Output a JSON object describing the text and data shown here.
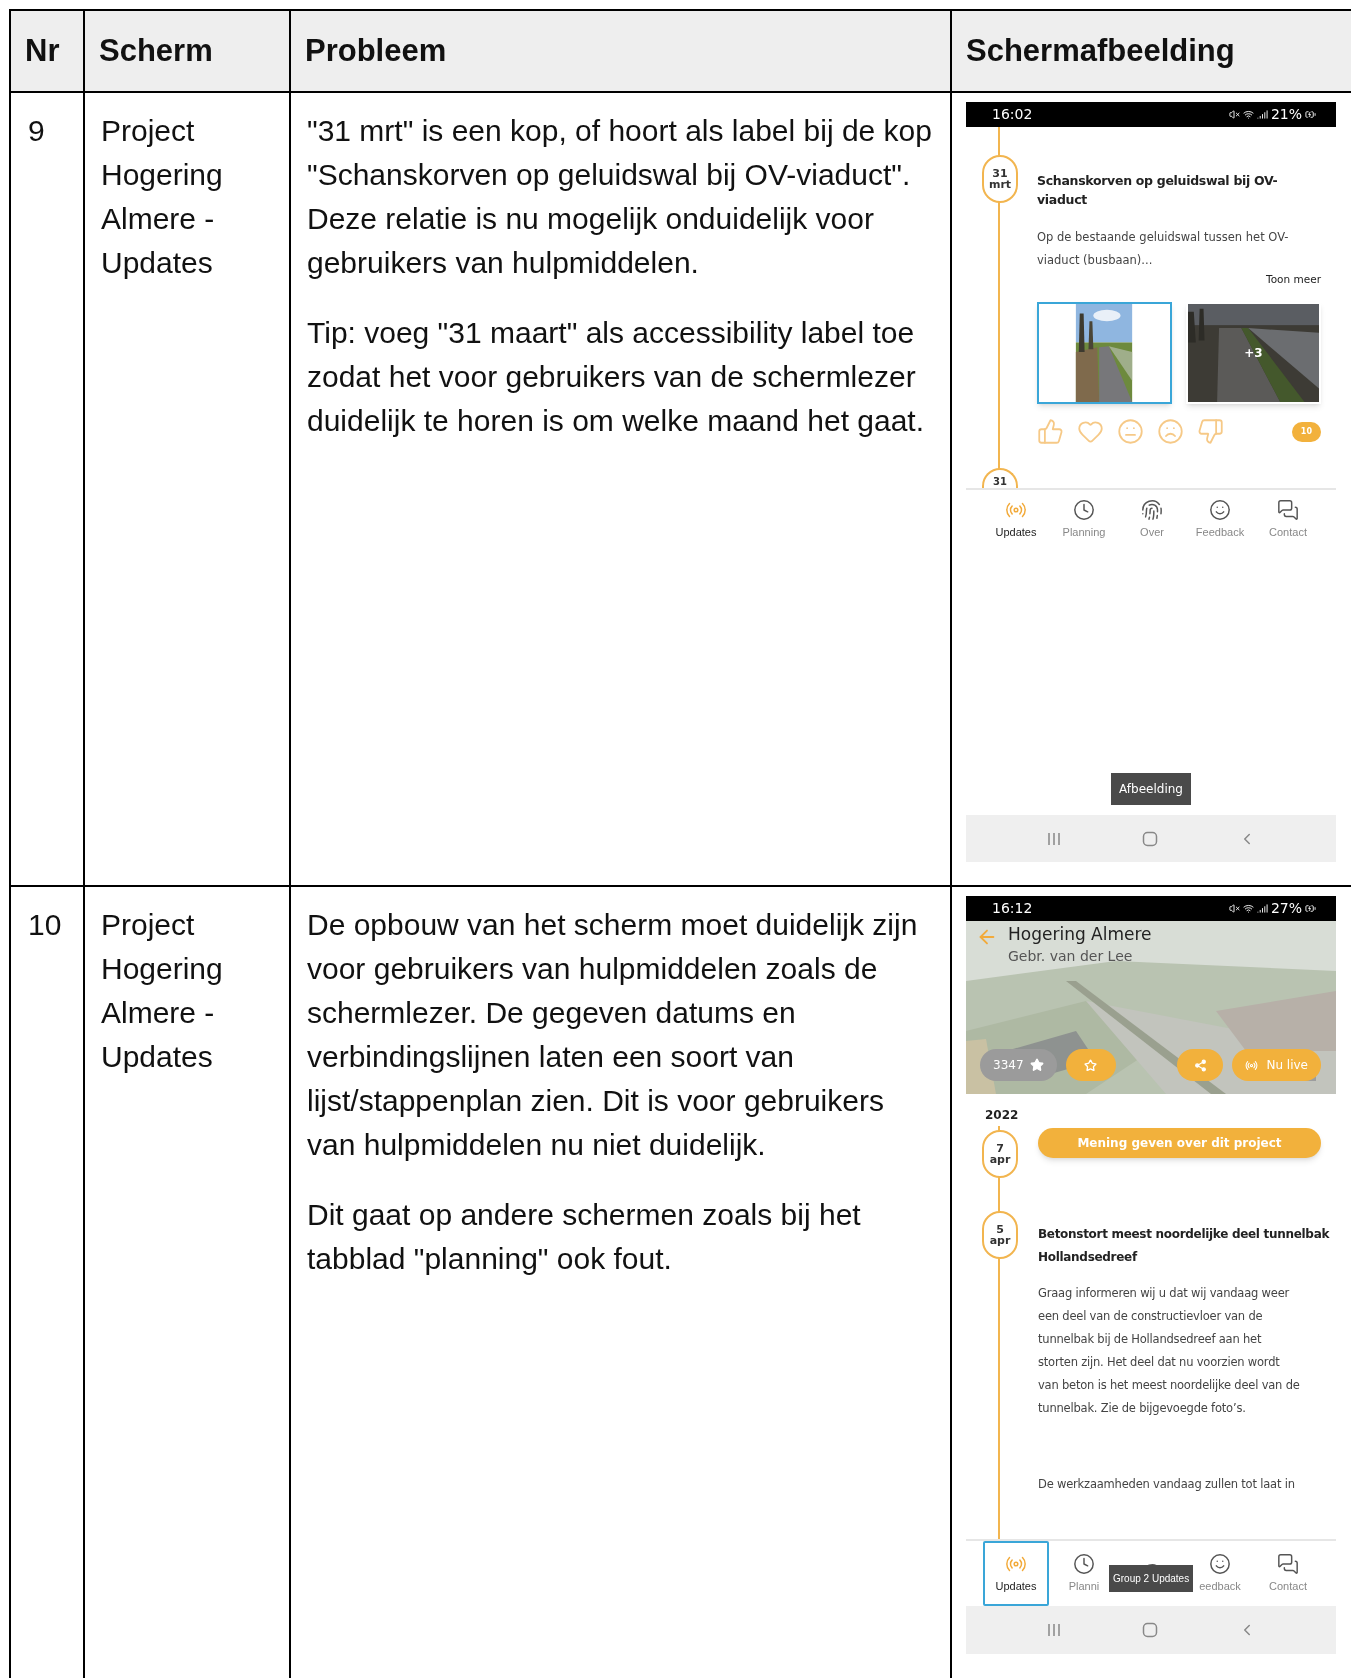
{
  "table": {
    "columns": [
      "Nr",
      "Scherm",
      "Probleem",
      "Schermafbeelding"
    ],
    "rows": [
      {
        "nr": "9",
        "screen": "Project Hogering Almere - Updates",
        "problem": [
          "\"31 mrt\" is een kop, of hoort als label bij de kop \"Schanskorven op geluidswal bij OV-viaduct\". Deze relatie is nu mogelijk onduidelijk voor gebruikers van hulpmiddelen.",
          "Tip: voeg \"31 maart\" als accessibility label toe zodat het voor gebruikers van de schermlezer duidelijk te horen is om welke maand het gaat."
        ],
        "screenshot": {
          "kind": "update_detail",
          "time": "16:02",
          "battery": "21%",
          "day": "31",
          "month": "mrt",
          "title": "Schanskorven op geluidswal bij OV-viaduct",
          "excerpt": [
            "Op de bestaande geluidswal tussen het OV-",
            "viaduct (busbaan)..."
          ],
          "more": "Toon meer",
          "images": [
            {
              "kind": "picture",
              "focused": true
            },
            {
              "kind": "picture",
              "focused": false,
              "overlay": "+3"
            }
          ],
          "reaction_count": "10",
          "next_day": "31",
          "nav": [
            {
              "label": "Updates",
              "selected": true,
              "focused": false
            },
            {
              "label": "Planning",
              "selected": false,
              "focused": false
            },
            {
              "label": "Over",
              "selected": false,
              "focused": false
            },
            {
              "label": "Feedback",
              "selected": false,
              "focused": false
            },
            {
              "label": "Contact",
              "selected": false,
              "focused": false
            }
          ],
          "tooltip": "Afbeelding"
        }
      },
      {
        "nr": "10",
        "screen": "Project Hogering Almere - Updates",
        "problem": [
          "De opbouw van het scherm moet duidelijk zijn voor gebruikers van hulpmiddelen zoals de schermlezer. De gegeven datums en verbindingslijnen laten een soort van lijst/stappenplan zien. Dit is voor gebruikers van hulpmiddelen nu niet duidelijk.",
          "Dit gaat op andere schermen zoals bij het tabblad \"planning\" ook fout."
        ],
        "screenshot": {
          "kind": "project_timeline",
          "time": "16:12",
          "battery": "27%",
          "project_title": "Hogering Almere",
          "company": "Gebr. van der Lee",
          "rating": "3347",
          "live": "Nu live",
          "year": "2022",
          "cta": "Mening geven over dit project",
          "entries": [
            {
              "day": "7",
              "month": "apr"
            },
            {
              "day": "5",
              "month": "apr",
              "title": [
                "Betonstort meest noordelijke deel tunnelbak",
                "Hollandsedreef"
              ],
              "paragraphs": [
                [
                  "Graag informeren wij u dat wij vandaag weer",
                  "een deel van de constructievloer van de",
                  "tunnelbak bij de Hollandsedreef aan het",
                  "storten zijn. Het deel dat nu voorzien wordt",
                  "van beton is het meest noordelijke deel van de",
                  "tunnelbak. Zie de bijgevoegde foto’s."
                ],
                [
                  "De werkzaamheden vandaag zullen tot laat in"
                ]
              ]
            }
          ],
          "nav": [
            {
              "label": "Updates",
              "selected": true,
              "focused": true
            },
            {
              "label": "Planni",
              "selected": false,
              "focused": false
            },
            {
              "selected": false,
              "focused": false
            },
            {
              "label": "eedback",
              "selected": false,
              "focused": false
            },
            {
              "label": "Contact",
              "selected": false,
              "focused": false
            }
          ],
          "tooltip": "Group 2 Updates"
        }
      }
    ]
  }
}
